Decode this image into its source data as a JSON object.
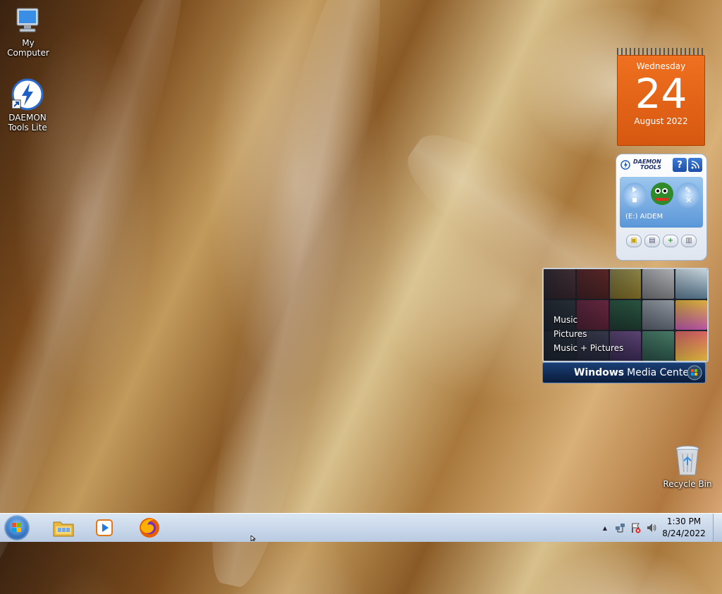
{
  "desktop": {
    "icons": [
      {
        "label": "My Computer",
        "icon": "computer-icon"
      },
      {
        "label": "DAEMON Tools Lite",
        "line1": "DAEMON",
        "line2": "Tools Lite",
        "icon": "daemon-tools-icon"
      },
      {
        "label": "Recycle Bin",
        "icon": "recycle-bin-icon"
      }
    ]
  },
  "calendar_gadget": {
    "weekday": "Wednesday",
    "day": "24",
    "month_year": "August 2022",
    "accent": "#e8651a"
  },
  "daemon_gadget": {
    "title_line1": "DAEMON",
    "title_line2": "TOOLS",
    "help_label": "?",
    "drive": "(E:) AIDEM"
  },
  "media_center_gadget": {
    "menu": [
      "Music",
      "Pictures",
      "Music + Pictures"
    ],
    "brand_bold": "Windows",
    "brand_rest": "Media Center"
  },
  "taskbar": {
    "pinned": [
      {
        "name": "windows-explorer",
        "icon": "folder-icon"
      },
      {
        "name": "windows-media-player",
        "icon": "media-player-icon"
      },
      {
        "name": "firefox",
        "icon": "firefox-icon"
      }
    ],
    "clock": {
      "time": "1:30 PM",
      "date": "8/24/2022"
    },
    "tray": {
      "expand_label": "▲"
    }
  }
}
